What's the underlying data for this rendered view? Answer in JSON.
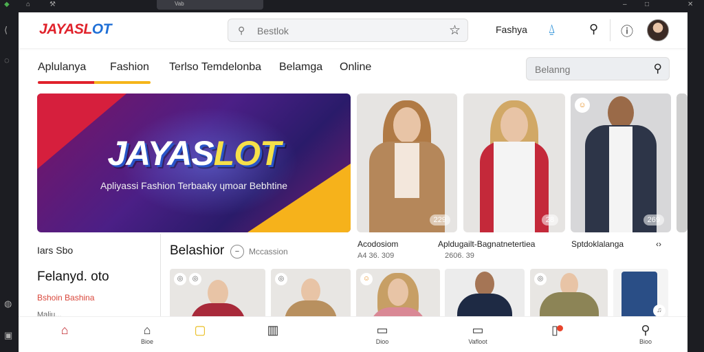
{
  "window": {
    "tab_label": "Vab"
  },
  "header": {
    "logo_part1": "JAYASL",
    "logo_part2": "OT",
    "search_placeholder": "Bestlok",
    "user_label": "Fashya"
  },
  "nav": {
    "tabs": [
      "Aplulanya",
      "Fashion",
      "Terlso Temdelonba",
      "Belamga",
      "Online"
    ],
    "search_placeholder": "Belanng"
  },
  "banner": {
    "title_part1": "JAYAS",
    "title_part2": "LOT",
    "subtitle": "Apliyassi Fashion Terbaaky ɥmoar Bebhtine"
  },
  "featured": [
    {
      "label": "Acodosiom",
      "sub": "A4 36. 309",
      "price": "229"
    },
    {
      "label": "Apldugailt-Bagnatnetertiea",
      "sub": "2606. 39",
      "price": "28"
    },
    {
      "label": "Sptdoklalanga",
      "sub": "",
      "price": "269"
    }
  ],
  "left_info": {
    "line1": "Iars  Sbo",
    "line2": "Felanyd. oto",
    "line3": "Bshoin  Bashina",
    "line4": "Maliu..."
  },
  "section": {
    "title": "Belashior",
    "subtitle": "Mccassion"
  },
  "bottom_nav": [
    {
      "icon": "home-icon",
      "label": ""
    },
    {
      "icon": "house-icon",
      "label": "Bioe"
    },
    {
      "icon": "chat-icon",
      "label": ""
    },
    {
      "icon": "book-icon",
      "label": ""
    },
    {
      "icon": "tray-icon",
      "label": "Dioo"
    },
    {
      "icon": "wallet-icon",
      "label": "Vafloot"
    },
    {
      "icon": "bookmark-icon",
      "label": ""
    },
    {
      "icon": "search-icon",
      "label": "Bioo"
    }
  ],
  "colors": {
    "brand_red": "#e0222b",
    "brand_blue": "#1f6fd6",
    "accent_yellow": "#f5b51a"
  }
}
